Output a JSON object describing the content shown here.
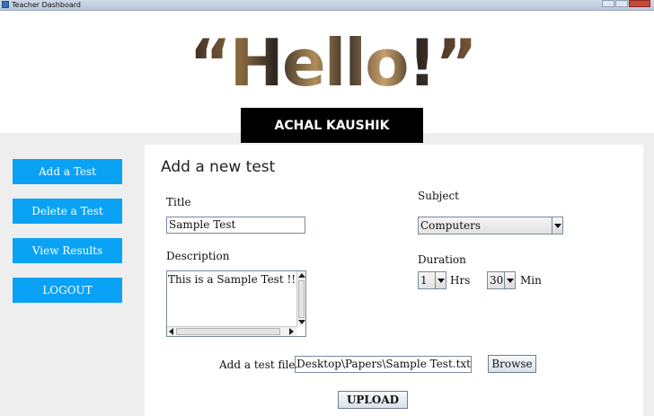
{
  "window": {
    "title": "Teacher Dashboard"
  },
  "header": {
    "greeting": "“Hello!”",
    "user_name": "ACHAL KAUSHIK"
  },
  "sidebar": {
    "items": [
      {
        "label": "Add a Test"
      },
      {
        "label": "Delete a Test"
      },
      {
        "label": "View Results"
      },
      {
        "label": "LOGOUT"
      }
    ]
  },
  "form": {
    "heading": "Add a new test",
    "title_label": "Title",
    "title_value": "Sample Test",
    "subject_label": "Subject",
    "subject_value": "Computers",
    "description_label": "Description",
    "description_value": "This is a Sample Test !!!",
    "duration_label": "Duration",
    "hours_value": "1",
    "hours_unit": "Hrs",
    "minutes_value": "30",
    "minutes_unit": "Min",
    "file_label": "Add a test file",
    "file_path": "ers\\Prashant\\Desktop\\Papers\\Sample Test.txt",
    "browse_label": "Browse",
    "upload_label": "UPLOAD"
  },
  "colors": {
    "nav_button": "#0aa2f5",
    "name_bar": "#000000"
  }
}
